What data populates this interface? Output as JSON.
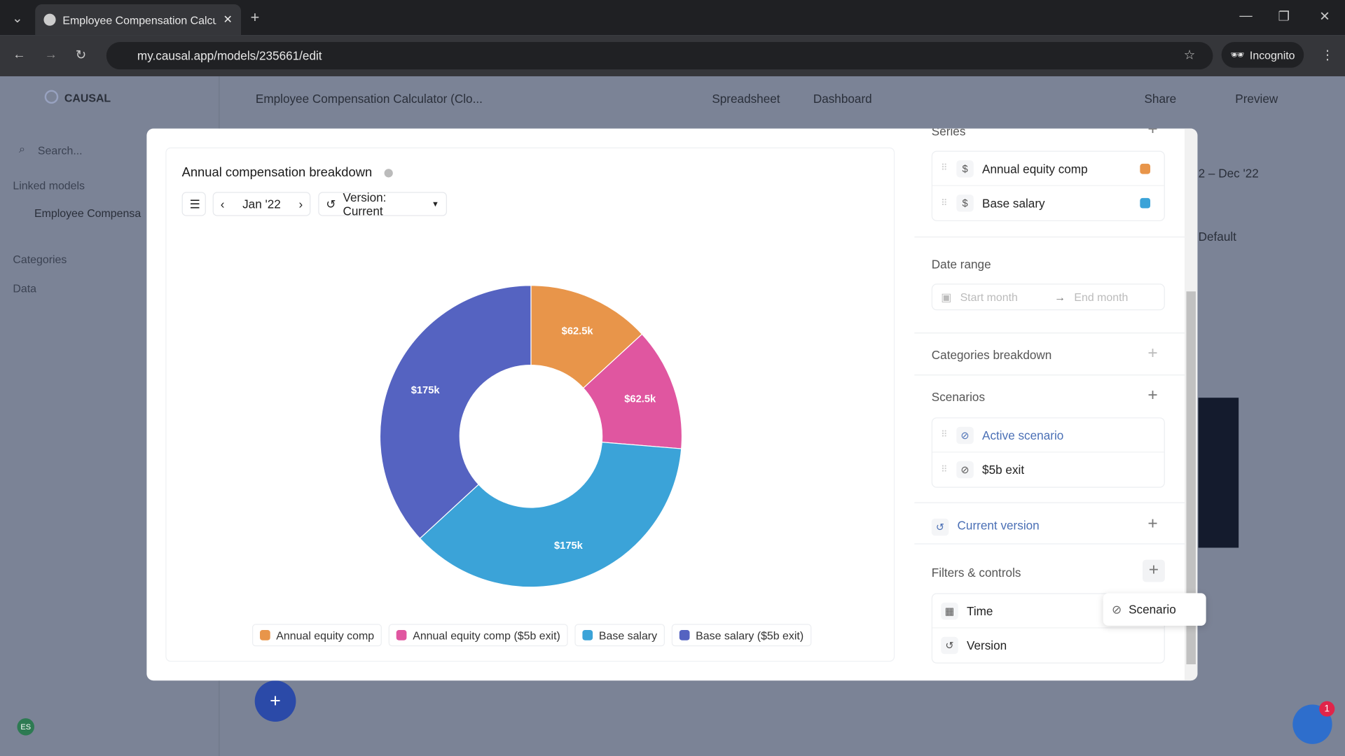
{
  "browser": {
    "tab_title": "Employee Compensation Calcul",
    "url": "my.causal.app/models/235661/edit",
    "incognito": "Incognito"
  },
  "app": {
    "logo": "CAUSAL",
    "model_title": "Employee Compensation Calculator (Clo...",
    "nav": [
      "Spreadsheet",
      "Dashboard"
    ],
    "share": "Share",
    "preview": "Preview",
    "avatar": "ES"
  },
  "sidebar": {
    "search_placeholder": "Search...",
    "linked_models": "Linked models",
    "model_item": "Employee Compensa",
    "categories": "Categories",
    "data": "Data"
  },
  "background": {
    "date_range": "2 – Dec '22",
    "default": "Default"
  },
  "chart_data": {
    "type": "pie",
    "title": "Annual compensation breakdown",
    "donut": true,
    "period": "Jan '22",
    "version_label": "Version:",
    "version_value": "Current",
    "slices": [
      {
        "name": "Annual equity comp",
        "value": 62.5,
        "label": "$62.5k",
        "color": "#E8954A"
      },
      {
        "name": "Annual equity comp ($5b exit)",
        "value": 62.5,
        "label": "$62.5k",
        "color": "#E056A0"
      },
      {
        "name": "Base salary",
        "value": 175,
        "label": "$175k",
        "color": "#3BA3D8"
      },
      {
        "name": "Base salary ($5b exit)",
        "value": 175,
        "label": "$175k",
        "color": "#5563C1"
      }
    ],
    "legend_placement": "bottom"
  },
  "panel": {
    "series_title": "Series",
    "series": [
      {
        "label": "Annual equity comp",
        "color": "#E8954A"
      },
      {
        "label": "Base salary",
        "color": "#3BA3D8"
      }
    ],
    "date_range_title": "Date range",
    "start_placeholder": "Start month",
    "end_placeholder": "End month",
    "categories_breakdown": "Categories breakdown",
    "scenarios_title": "Scenarios",
    "scenarios": [
      "Active scenario",
      "$5b exit"
    ],
    "current_version": "Current version",
    "filters_title": "Filters & controls",
    "filters": [
      "Time",
      "Version"
    ],
    "dropdown_option": "Scenario"
  },
  "chat_badge": "1"
}
